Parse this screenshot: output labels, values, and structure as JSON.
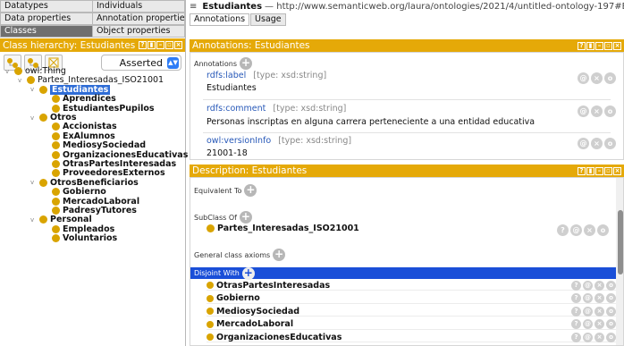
{
  "left": {
    "tabs_row1": [
      "Datatypes",
      "Individuals"
    ],
    "tabs_row2": [
      "Data properties",
      "Annotation properties"
    ],
    "tabs_row3": [
      "Classes",
      "Object properties"
    ],
    "header_title": "Class hierarchy: Estudiantes",
    "dropdown_value": "Asserted",
    "tree": [
      {
        "label": "owl:Thing",
        "depth": 0,
        "bold": false,
        "toggle": "v"
      },
      {
        "label": "Partes_Interesadas_ISO21001",
        "depth": 1,
        "bold": false,
        "toggle": "v"
      },
      {
        "label": "Estudiantes",
        "depth": 2,
        "bold": true,
        "toggle": "v",
        "selected": true
      },
      {
        "label": "Aprendices",
        "depth": 3,
        "bold": true
      },
      {
        "label": "EstudiantesPupilos",
        "depth": 3,
        "bold": true
      },
      {
        "label": "Otros",
        "depth": 2,
        "bold": true,
        "toggle": "v"
      },
      {
        "label": "Accionistas",
        "depth": 3,
        "bold": true
      },
      {
        "label": "ExAlumnos",
        "depth": 3,
        "bold": true
      },
      {
        "label": "MediosySociedad",
        "depth": 3,
        "bold": true
      },
      {
        "label": "OrganizacionesEducativas",
        "depth": 3,
        "bold": true
      },
      {
        "label": "OtrasPartesInteresadas",
        "depth": 3,
        "bold": true
      },
      {
        "label": "ProveedoresExternos",
        "depth": 3,
        "bold": true
      },
      {
        "label": "OtrosBeneficiarios",
        "depth": 2,
        "bold": true,
        "toggle": "v"
      },
      {
        "label": "Gobierno",
        "depth": 3,
        "bold": true
      },
      {
        "label": "MercadoLaboral",
        "depth": 3,
        "bold": true
      },
      {
        "label": "PadresyTutores",
        "depth": 3,
        "bold": true
      },
      {
        "label": "Personal",
        "depth": 2,
        "bold": true,
        "toggle": "v"
      },
      {
        "label": "Empleados",
        "depth": 3,
        "bold": true
      },
      {
        "label": "Voluntarios",
        "depth": 3,
        "bold": true
      }
    ]
  },
  "right": {
    "title_name": "Estudiantes",
    "title_iri": "— http://www.semanticweb.org/laura/ontologies/2021/4/untitled-ontology-197#Estudia",
    "tabs": [
      "Annotations",
      "Usage"
    ],
    "annotations_header": "Annotations: Estudiantes",
    "annotations_label": "Annotations",
    "annotations": [
      {
        "property": "rdfs:label",
        "type": "[type: xsd:string]",
        "value": "Estudiantes"
      },
      {
        "property": "rdfs:comment",
        "type": "[type: xsd:string]",
        "value": "Personas inscriptas en alguna carrera perteneciente a una entidad educativa"
      },
      {
        "property": "owl:versionInfo",
        "type": "[type: xsd:string]",
        "value": "21001-18"
      }
    ],
    "description_header": "Description: Estudiantes",
    "equivalent_label": "Equivalent To",
    "subclass_label": "SubClass Of",
    "subclass_value": "Partes_Interesadas_ISO21001",
    "general_axioms_label": "General class axioms",
    "disjoint_label": "Disjoint With",
    "disjoint": [
      "OtrasPartesInteresadas",
      "Gobierno",
      "MediosySociedad",
      "MercadoLaboral",
      "OrganizacionesEducativas"
    ]
  },
  "colors": {
    "header": "#e5a908",
    "class_dot": "#d9a400",
    "selection": "#2f6dd6",
    "disjoint_bar": "#1a4fd8"
  }
}
